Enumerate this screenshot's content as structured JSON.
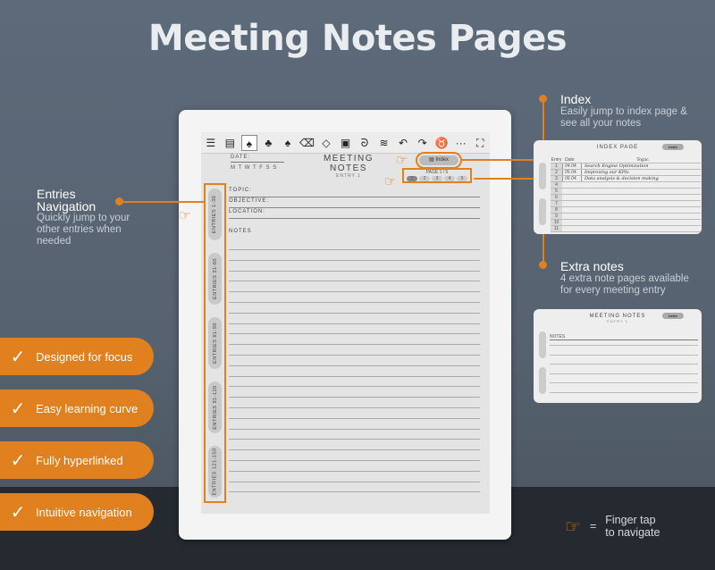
{
  "title": "Meeting Notes Pages",
  "toolbar_icons": [
    "sidebar-icon",
    "list-icon",
    "pen-icon",
    "brush-icon",
    "marker-icon",
    "eraser-icon",
    "selection-eraser-icon",
    "image-icon",
    "lasso-icon",
    "layers-icon",
    "undo-icon",
    "redo-icon",
    "clear-icon",
    "more-icon",
    "fullscreen-icon"
  ],
  "page": {
    "date_label": "DATE:",
    "weekdays": "M  T  W  T  F  S  S",
    "title": "MEETING NOTES",
    "entry": "ENTRY 1",
    "index_button": "Index",
    "page_label": "PAGE 1 / 5",
    "pages": [
      "1",
      "2",
      "3",
      "4",
      "5"
    ],
    "fields": [
      "TOPIC:",
      "OBJECTIVE:",
      "LOCATION:"
    ],
    "notes_label": "NOTES",
    "entry_tabs": [
      "ENTRIES 1-30",
      "ENTRIES 31-60",
      "ENTRIES 61-90",
      "ENTRIES 91-120",
      "ENTRIES 121-150"
    ]
  },
  "callouts": {
    "entries": {
      "title": "Entries Navigation",
      "desc": "Quickly jump to your other entries when needed"
    },
    "index": {
      "title": "Index",
      "desc": "Easily jump to index page & see all your notes"
    },
    "extra": {
      "title": "Extra notes",
      "desc": "4 extra note pages available for every meeting entry"
    }
  },
  "index_preview": {
    "title": "INDEX PAGE",
    "button": "Index",
    "headers": [
      "Entry",
      "Date",
      "Topic"
    ],
    "rows": [
      [
        "1",
        "04.04.",
        "Search Engine Optimization"
      ],
      [
        "2",
        "05.04.",
        "Improving our KPIs"
      ],
      [
        "3",
        "06.04.",
        "Data analysis & decision making"
      ],
      [
        "4",
        "",
        ""
      ],
      [
        "5",
        "",
        ""
      ],
      [
        "6",
        "",
        ""
      ],
      [
        "7",
        "",
        ""
      ],
      [
        "8",
        "",
        ""
      ],
      [
        "9",
        "",
        ""
      ],
      [
        "10",
        "",
        ""
      ],
      [
        "11",
        "",
        ""
      ]
    ]
  },
  "notes_preview": {
    "title": "MEETING NOTES",
    "entry": "ENTRY 1",
    "button": "Index",
    "notes_label": "NOTES"
  },
  "features": [
    "Designed for focus",
    "Easy learning curve",
    "Fully hyperlinked",
    "Intuitive navigation"
  ],
  "legend": {
    "equals": "=",
    "line1": "Finger tap",
    "line2": "to navigate"
  },
  "colors": {
    "accent": "#e0801f",
    "background": "#5a6676",
    "band": "#252a31"
  }
}
